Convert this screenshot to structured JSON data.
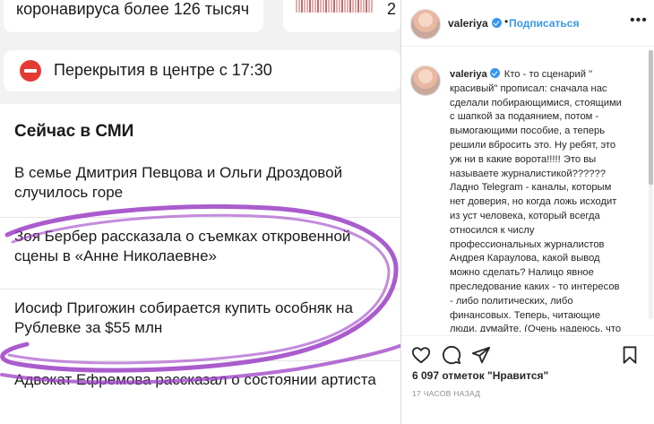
{
  "news": {
    "top_card_text": "коронавируса более 126 тысяч",
    "top_card_number": "2",
    "closure_alert": "Перекрытия в центре с 17:30",
    "section_heading": "Сейчас в СМИ",
    "items": [
      "В семье Дмитрия Певцова и Ольги Дроздовой случилось горе",
      "Зоя Бербер рассказала о съемках откровенной сцены в «Анне Николаевне»",
      "Иосиф Пригожин собирается купить особняк на Рублевке за $55 млн",
      "Адвокат Ефремова рассказал о состоянии артиста"
    ],
    "scribble_color": "#9b3fc4",
    "alert_color": "#e53935"
  },
  "instagram": {
    "header": {
      "username": "valeriya",
      "dot": "•",
      "follow_label": "Подписаться",
      "more_icon": "•••"
    },
    "caption": {
      "username": "valeriya",
      "text": "Кто - то сценарий \" красивый\" прописал: сначала нас сделали побирающимися, стоящими с шапкой за подаянием, потом - вымогающими пособие, а теперь решили вбросить это. Ну ребят, это уж ни в какие ворота!!!!! Это вы называете журналистикой?????? Ладно Telegram - каналы, которым нет доверия, но когда ложь исходит из уст человека, который всегда относился к числу профессиональных журналистов Андрея Караулова, какой вывод можно сделать? Налицо явное преследование каких - то интересов - либо политических, либо финансовых. Теперь, читающие люди, думайте. (Очень надеюсь, что умеющие это делать ещё не"
    },
    "icons": [
      "heart-icon",
      "comment-icon",
      "share-icon",
      "bookmark-icon"
    ],
    "likes": "6 097 отметок \"Нравится\"",
    "timestamp": "17 ЧАСОВ НАЗАД",
    "link_color": "#3897f0"
  }
}
